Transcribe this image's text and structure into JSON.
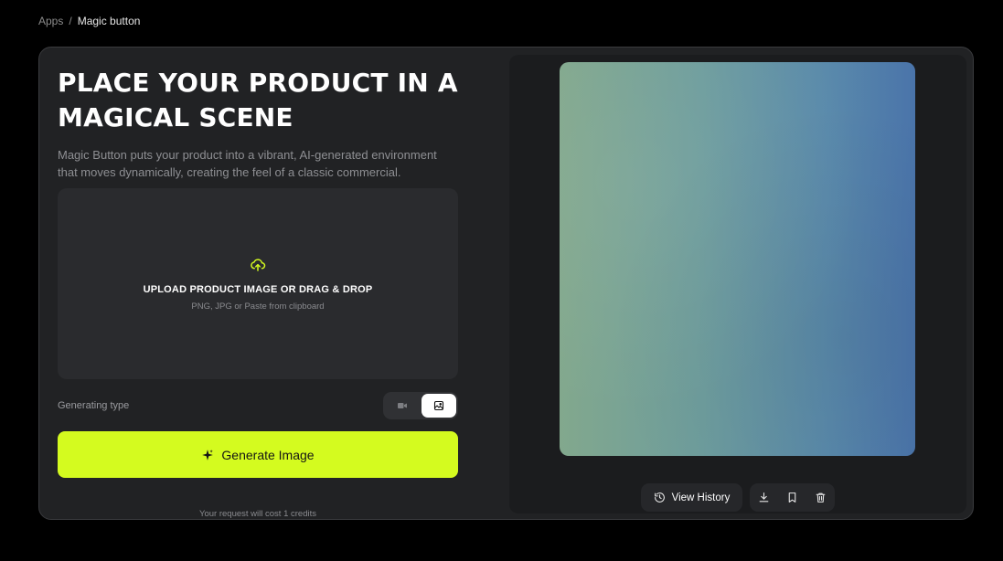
{
  "breadcrumb": {
    "parent": "Apps",
    "separator": "/",
    "current": "Magic button"
  },
  "hero": {
    "title_line1": "PLACE YOUR PRODUCT IN A",
    "title_line2": "MAGICAL SCENE",
    "description": "Magic Button puts your product into a vibrant, AI-generated environment that moves dynamically, creating the feel of a classic commercial."
  },
  "upload": {
    "icon": "cloud-upload-icon",
    "title": "UPLOAD PRODUCT IMAGE OR DRAG & DROP",
    "subtitle": "PNG, JPG or Paste from clipboard"
  },
  "generating_type": {
    "label": "Generating type",
    "options": [
      {
        "id": "video",
        "icon": "video-icon",
        "selected": false
      },
      {
        "id": "image",
        "icon": "image-icon",
        "selected": true
      }
    ]
  },
  "generate_button": {
    "icon": "sparkle-icon",
    "label": "Generate Image"
  },
  "cost_note": "Your request will cost 1 credits",
  "preview_actions": {
    "history_label": "View History",
    "history_icon": "history-icon",
    "icons": [
      "download-icon",
      "bookmark-icon",
      "trash-icon"
    ]
  },
  "colors": {
    "accent": "#d4fb1f",
    "panel": "#212224",
    "background": "#000000"
  }
}
